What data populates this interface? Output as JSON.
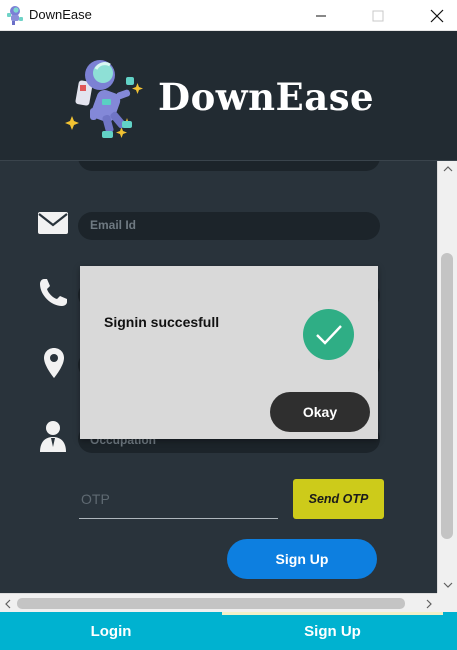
{
  "window": {
    "title": "DownEase"
  },
  "header": {
    "brand": "DownEase"
  },
  "form": {
    "email_placeholder": "Email Id",
    "occupation_placeholder": "Occupation",
    "otp_placeholder": "OTP",
    "send_otp_label": "Send OTP",
    "signup_label": "Sign Up"
  },
  "dialog": {
    "message": "Signin succesfull",
    "ok_label": "Okay"
  },
  "tabs": {
    "login": "Login",
    "signup": "Sign Up"
  },
  "colors": {
    "header_bg": "#222b32",
    "content_bg": "#29333b",
    "accent_blue": "#0d7fe0",
    "send_otp": "#cdcb1a",
    "success_green": "#2fae85",
    "tab_bar": "#00b2d0"
  },
  "icons": [
    "app-icon",
    "minimize-icon",
    "maximize-icon",
    "close-icon",
    "astronaut-logo-icon",
    "mail-icon",
    "phone-icon",
    "location-pin-icon",
    "user-icon",
    "checkmark-icon"
  ]
}
